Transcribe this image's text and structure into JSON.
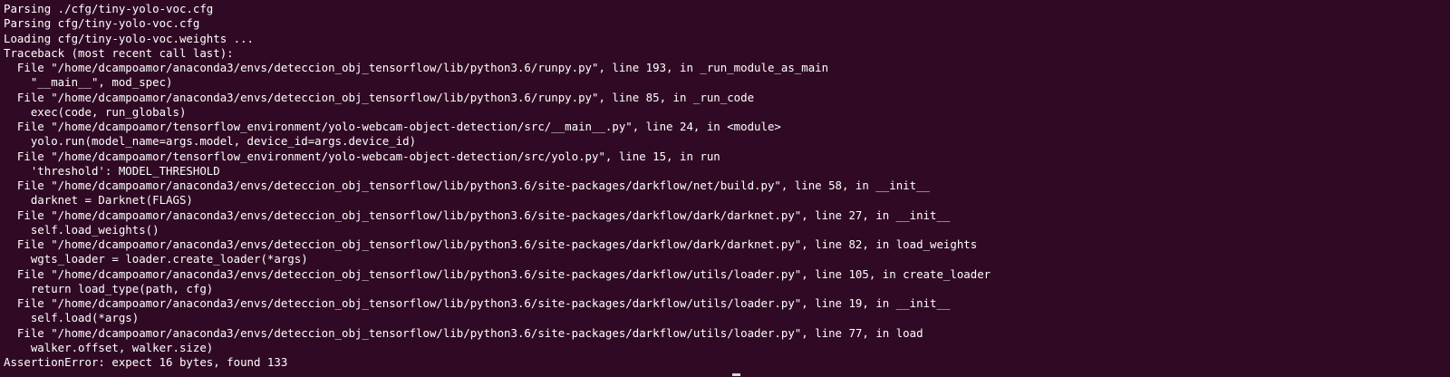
{
  "terminal": {
    "colors": {
      "background": "#300a24",
      "text": "#ffffff"
    },
    "lines": [
      "Parsing ./cfg/tiny-yolo-voc.cfg",
      "Parsing cfg/tiny-yolo-voc.cfg",
      "Loading cfg/tiny-yolo-voc.weights ...",
      "Traceback (most recent call last):",
      "  File \"/home/dcampoamor/anaconda3/envs/deteccion_obj_tensorflow/lib/python3.6/runpy.py\", line 193, in _run_module_as_main",
      "    \"__main__\", mod_spec)",
      "  File \"/home/dcampoamor/anaconda3/envs/deteccion_obj_tensorflow/lib/python3.6/runpy.py\", line 85, in _run_code",
      "    exec(code, run_globals)",
      "  File \"/home/dcampoamor/tensorflow_environment/yolo-webcam-object-detection/src/__main__.py\", line 24, in <module>",
      "    yolo.run(model_name=args.model, device_id=args.device_id)",
      "  File \"/home/dcampoamor/tensorflow_environment/yolo-webcam-object-detection/src/yolo.py\", line 15, in run",
      "    'threshold': MODEL_THRESHOLD",
      "  File \"/home/dcampoamor/anaconda3/envs/deteccion_obj_tensorflow/lib/python3.6/site-packages/darkflow/net/build.py\", line 58, in __init__",
      "    darknet = Darknet(FLAGS)",
      "  File \"/home/dcampoamor/anaconda3/envs/deteccion_obj_tensorflow/lib/python3.6/site-packages/darkflow/dark/darknet.py\", line 27, in __init__",
      "    self.load_weights()",
      "  File \"/home/dcampoamor/anaconda3/envs/deteccion_obj_tensorflow/lib/python3.6/site-packages/darkflow/dark/darknet.py\", line 82, in load_weights",
      "    wgts_loader = loader.create_loader(*args)",
      "  File \"/home/dcampoamor/anaconda3/envs/deteccion_obj_tensorflow/lib/python3.6/site-packages/darkflow/utils/loader.py\", line 105, in create_loader",
      "    return load_type(path, cfg)",
      "  File \"/home/dcampoamor/anaconda3/envs/deteccion_obj_tensorflow/lib/python3.6/site-packages/darkflow/utils/loader.py\", line 19, in __init__",
      "    self.load(*args)",
      "  File \"/home/dcampoamor/anaconda3/envs/deteccion_obj_tensorflow/lib/python3.6/site-packages/darkflow/utils/loader.py\", line 77, in load",
      "    walker.offset, walker.size)",
      "AssertionError: expect 16 bytes, found 133"
    ]
  }
}
